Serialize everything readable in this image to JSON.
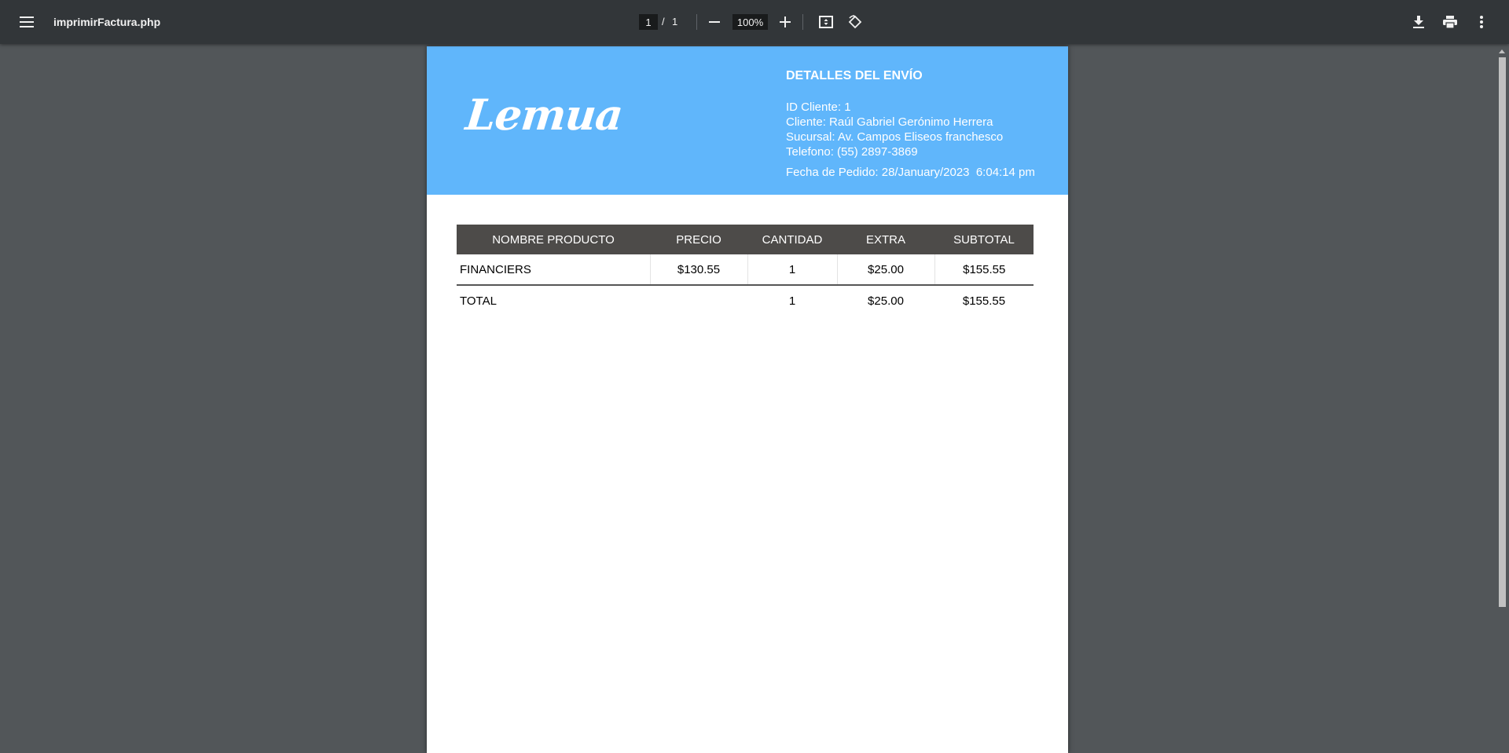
{
  "toolbar": {
    "title": "imprimirFactura.php",
    "page_current": "1",
    "page_separator": "/",
    "page_total": "1",
    "zoom": "100%",
    "icons": {
      "menu": "menu-icon",
      "zoom_out": "minus-icon",
      "zoom_in": "plus-icon",
      "fit": "fit-page-icon",
      "rotate": "rotate-icon",
      "download": "download-icon",
      "print": "print-icon",
      "more": "more-vert-icon"
    }
  },
  "document": {
    "logo": "Lemua",
    "header_color": "#60b6fb",
    "shipping": {
      "title": "DETALLES DEL ENVÍO",
      "client_id": "ID Cliente: 1",
      "client": "Cliente: Raúl Gabriel Gerónimo Herrera",
      "branch": "Sucursal: Av. Campos Eliseos franchesco",
      "phone": "Telefono: (55) 2897-3869",
      "order_date": "Fecha de Pedido: 28/January/2023  6:04:14 pm"
    },
    "table": {
      "headers": [
        "NOMBRE PRODUCTO",
        "PRECIO",
        "CANTIDAD",
        "EXTRA",
        "SUBTOTAL"
      ],
      "rows": [
        [
          "FINANCIERS",
          "$130.55",
          "1",
          "$25.00",
          "$155.55"
        ]
      ],
      "total": [
        "TOTAL",
        "",
        "1",
        "$25.00",
        "$155.55"
      ]
    }
  }
}
